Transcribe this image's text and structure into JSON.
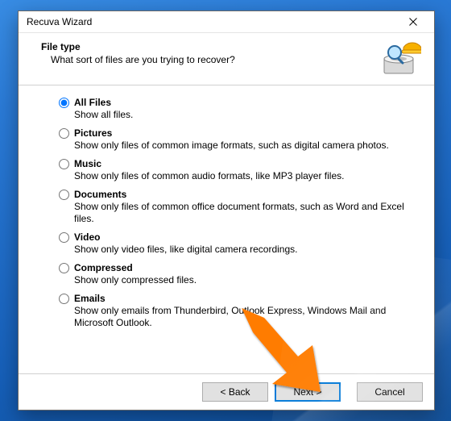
{
  "window": {
    "title": "Recuva Wizard"
  },
  "header": {
    "heading": "File type",
    "subheading": "What sort of files are you trying to recover?"
  },
  "options": [
    {
      "id": "all",
      "label": "All Files",
      "desc": "Show all files.",
      "selected": true
    },
    {
      "id": "pictures",
      "label": "Pictures",
      "desc": "Show only files of common image formats, such as digital camera photos.",
      "selected": false
    },
    {
      "id": "music",
      "label": "Music",
      "desc": "Show only files of common audio formats, like MP3 player files.",
      "selected": false
    },
    {
      "id": "documents",
      "label": "Documents",
      "desc": "Show only files of common office document formats, such as Word and Excel files.",
      "selected": false
    },
    {
      "id": "video",
      "label": "Video",
      "desc": "Show only video files, like digital camera recordings.",
      "selected": false
    },
    {
      "id": "compressed",
      "label": "Compressed",
      "desc": "Show only compressed files.",
      "selected": false
    },
    {
      "id": "emails",
      "label": "Emails",
      "desc": "Show only emails from Thunderbird, Outlook Express, Windows Mail and Microsoft Outlook.",
      "selected": false
    }
  ],
  "buttons": {
    "back": "< Back",
    "next": "Next >",
    "cancel": "Cancel"
  }
}
